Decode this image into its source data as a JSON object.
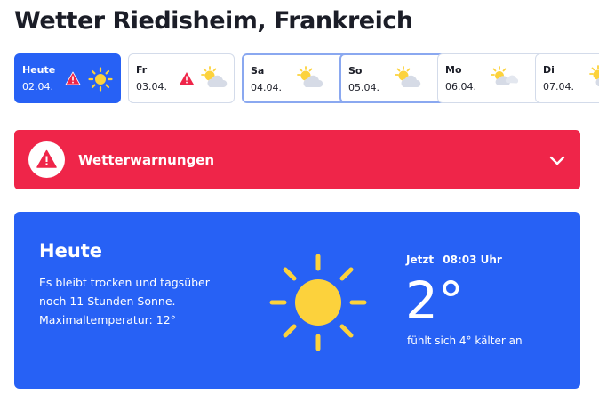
{
  "page": {
    "title": "Wetter Riedisheim, Frankreich"
  },
  "days": [
    {
      "name": "Heute",
      "date": "02.04.",
      "warning": true,
      "icon": "sun-icon"
    },
    {
      "name": "Fr",
      "date": "03.04.",
      "warning": true,
      "icon": "sun-cloud-icon"
    },
    {
      "name": "Sa",
      "date": "04.04.",
      "warning": false,
      "icon": "sun-cloud-icon"
    },
    {
      "name": "So",
      "date": "05.04.",
      "warning": false,
      "icon": "sun-cloud-icon"
    },
    {
      "name": "Mo",
      "date": "06.04.",
      "warning": false,
      "icon": "sun-clouds-icon"
    },
    {
      "name": "Di",
      "date": "07.04.",
      "warning": false,
      "icon": "sun-cloud-icon"
    }
  ],
  "alert": {
    "label": "Wetterwarnungen",
    "color": "#ef2549"
  },
  "today": {
    "heading": "Heute",
    "description": "Es bleibt trocken und tagsüber noch 11 Stunden Sonne. Maximaltemperatur: 12°",
    "now_label": "Jetzt",
    "time": "08:03 Uhr",
    "temperature": "2°",
    "feels_like": "fühlt sich 4° kälter an",
    "icon": "sun-icon"
  },
  "colors": {
    "accent": "#2761f5",
    "sun": "#fcd23c",
    "warning": "#ef2549"
  }
}
